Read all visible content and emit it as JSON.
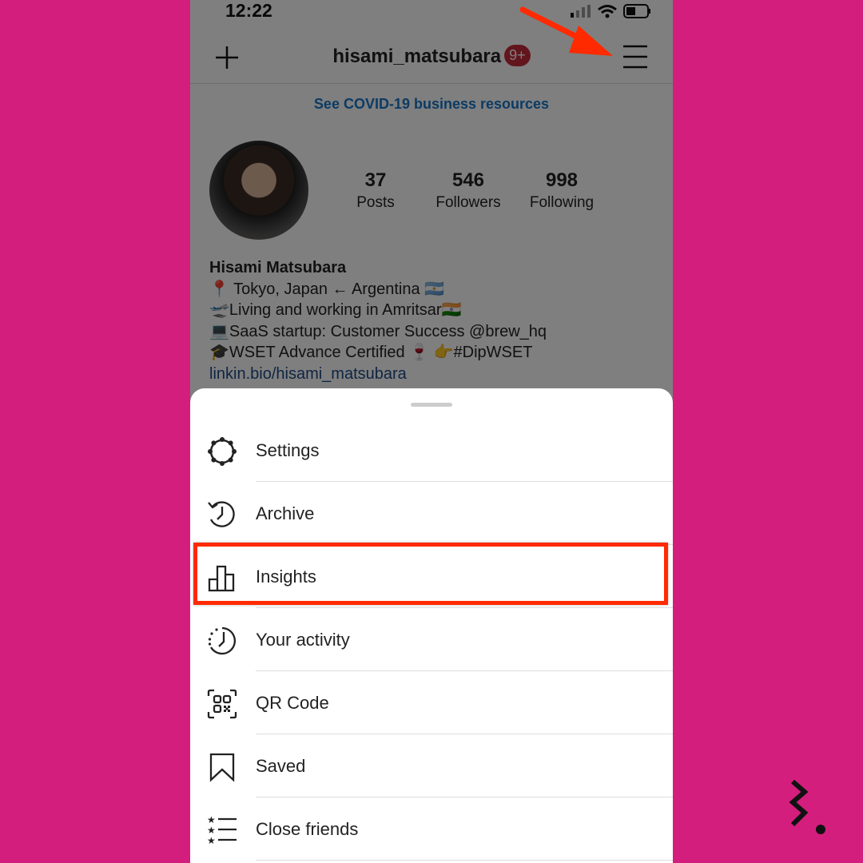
{
  "status": {
    "time": "12:22"
  },
  "header": {
    "username": "hisami_matsubara",
    "badge": "9+",
    "banner": "See COVID-19 business resources"
  },
  "stats": [
    {
      "n": "37",
      "l": "Posts"
    },
    {
      "n": "546",
      "l": "Followers"
    },
    {
      "n": "998",
      "l": "Following"
    }
  ],
  "bio": {
    "name": "Hisami Matsubara",
    "lines": [
      "📍 Tokyo, Japan ← Argentina 🇦🇷",
      "🛫Living and working in Amritsar🇮🇳",
      "💻SaaS startup: Customer Success @brew_hq",
      "🎓WSET Advance Certified 🍷 👉#DipWSET"
    ],
    "link": "linkin.bio/hisami_matsubara"
  },
  "menu": [
    {
      "label": "Settings",
      "icon": "settings-icon"
    },
    {
      "label": "Archive",
      "icon": "archive-icon"
    },
    {
      "label": "Insights",
      "icon": "insights-icon"
    },
    {
      "label": "Your activity",
      "icon": "activity-icon"
    },
    {
      "label": "QR Code",
      "icon": "qr-code-icon"
    },
    {
      "label": "Saved",
      "icon": "bookmark-icon"
    },
    {
      "label": "Close friends",
      "icon": "close-friends-icon"
    }
  ],
  "colors": {
    "background": "#d41e7e",
    "highlight": "#ff2a00",
    "link": "#1877c9"
  }
}
